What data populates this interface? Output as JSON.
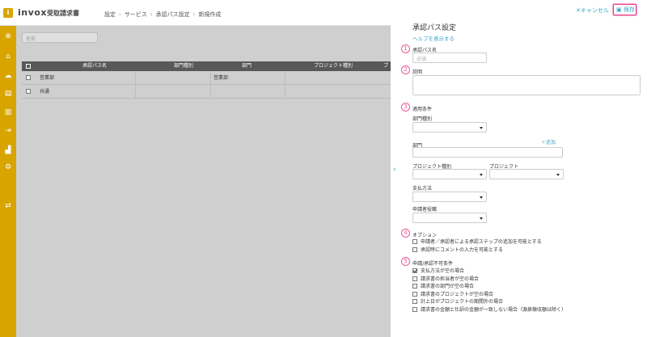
{
  "header": {
    "logo_mark": "i",
    "logo": "invox",
    "product": "受取請求書",
    "breadcrumb": [
      "設定",
      "サービス",
      "承認パス設定",
      "新規作成"
    ]
  },
  "rail_icons": [
    "plus-circle-icon",
    "home-icon",
    "cloud-upload-icon",
    "document-icon",
    "building-icon",
    "export-icon",
    "chart-icon",
    "gear-icon",
    "transfer-icon"
  ],
  "list": {
    "search_placeholder": "名前",
    "columns": [
      "承認パス名",
      "部門種別",
      "部門",
      "プロジェクト種別",
      "プ"
    ],
    "rows": [
      {
        "name": "営業部",
        "dept_type": "",
        "dept": "営業部",
        "proj_type": ""
      },
      {
        "name": "共通",
        "dept_type": "",
        "dept": "",
        "proj_type": ""
      }
    ]
  },
  "panel": {
    "cancel_label": "キャンセル",
    "save_label": "保存",
    "title": "承認パス設定",
    "help_link": "ヘルプを表示する",
    "step_numbers": [
      "1",
      "2",
      "3",
      "4",
      "5"
    ],
    "name_label": "承認パス名",
    "name_placeholder": "必須",
    "description_label": "説明",
    "conditions_label": "適用条件",
    "dept_type_label": "部門種別",
    "dept_label": "部門",
    "add_label": "追加",
    "project_type_label": "プロジェクト種別",
    "project_label": "プロジェクト",
    "payment_label": "支払方法",
    "applicant_role_label": "申請者役職",
    "options_label": "オプション",
    "options": [
      {
        "label": "申請者／承認者による承認ステップの追加を可能とする",
        "checked": false
      },
      {
        "label": "承認時にコメントの入力を可能とする",
        "checked": false
      }
    ],
    "denial_label": "申請/承認不可条件",
    "denial": [
      {
        "label": "支払方法が空の場合",
        "checked": true
      },
      {
        "label": "請求書の担当者が空の場合",
        "checked": false
      },
      {
        "label": "請求書の部門が空の場合",
        "checked": false
      },
      {
        "label": "請求書のプロジェクトが空の場合",
        "checked": false
      },
      {
        "label": "計上日がプロジェクトの期間外の場合",
        "checked": false
      },
      {
        "label": "請求書の金額と仕訳の金額が一致しない場合（源泉徴収額は除く）",
        "checked": false
      }
    ]
  }
}
